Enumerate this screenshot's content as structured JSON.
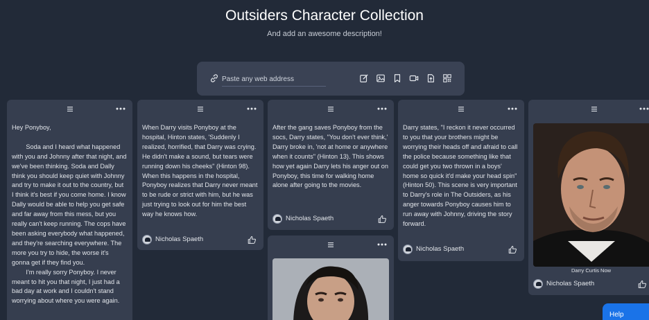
{
  "page": {
    "title": "Outsiders Character Collection",
    "description": "And add an awesome description!"
  },
  "composer": {
    "placeholder": "Paste any web address",
    "tools": [
      "link-icon",
      "edit-icon",
      "image-icon",
      "bookmark-icon",
      "video-icon",
      "upload-icon",
      "qr-code-icon"
    ]
  },
  "cards": [
    {
      "text": "Hey Ponyboy,\n\n        Soda and I heard what happened with you and Johnny after that night, and we've been thinking. Soda and Dally think you should keep quiet with Johnny and try to make it out to the country, but I think it's best if you come home. I know Dally would be able to help you get safe and far away from this mess, but you really can't keep running. The cops have been asking everybody what happened, and they're searching everywhere. The more you try to hide, the worse it's gonna get if they find you.\n        I'm really sorry Ponyboy. I never meant to hit you that night, I just had a bad day at work and I couldn't stand worrying about where you were again."
    },
    {
      "text": "When Darry visits Ponyboy at the hospital, Hinton states, 'Suddenly I realized, horrified, that Darry was crying. He didn't make a sound, but tears were running down his cheeks\" (Hinton 98). When this happens in the hospital, Ponyboy realizes that Darry never meant to be rude or strict with him, but he was just trying to look out for him the best way he knows how.",
      "author": "Nicholas Spaeth"
    },
    {
      "text": "After the gang saves Ponyboy from the socs, Darry states, \"You don't ever think,' Darry broke in, 'not at home or anywhere when it counts\" (Hinton 13). This shows how yet again Darry lets his anger out on Ponyboy, this time for walking home alone after going to the movies.",
      "author": "Nicholas Spaeth"
    },
    {
      "text": "Darry states, \"I reckon it never occurred to you that your brothers might be worrying their heads off and afraid to call the police because something like that could get you two thrown in a boys' home so quick it'd make your head spin\" (Hinton 50). This scene is very important to Darry's role in The Outsiders, as his anger towards Ponyboy causes him to run away with Johnny, driving the story forward.",
      "author": "Nicholas Spaeth"
    },
    {
      "caption": "Darry Curtis Now",
      "author": "Nicholas Spaeth"
    }
  ],
  "help": {
    "label": "Help"
  },
  "colors": {
    "background": "#222a38",
    "card": "#363e4f",
    "composer": "#3a4254",
    "help_button": "#1a73e8"
  }
}
